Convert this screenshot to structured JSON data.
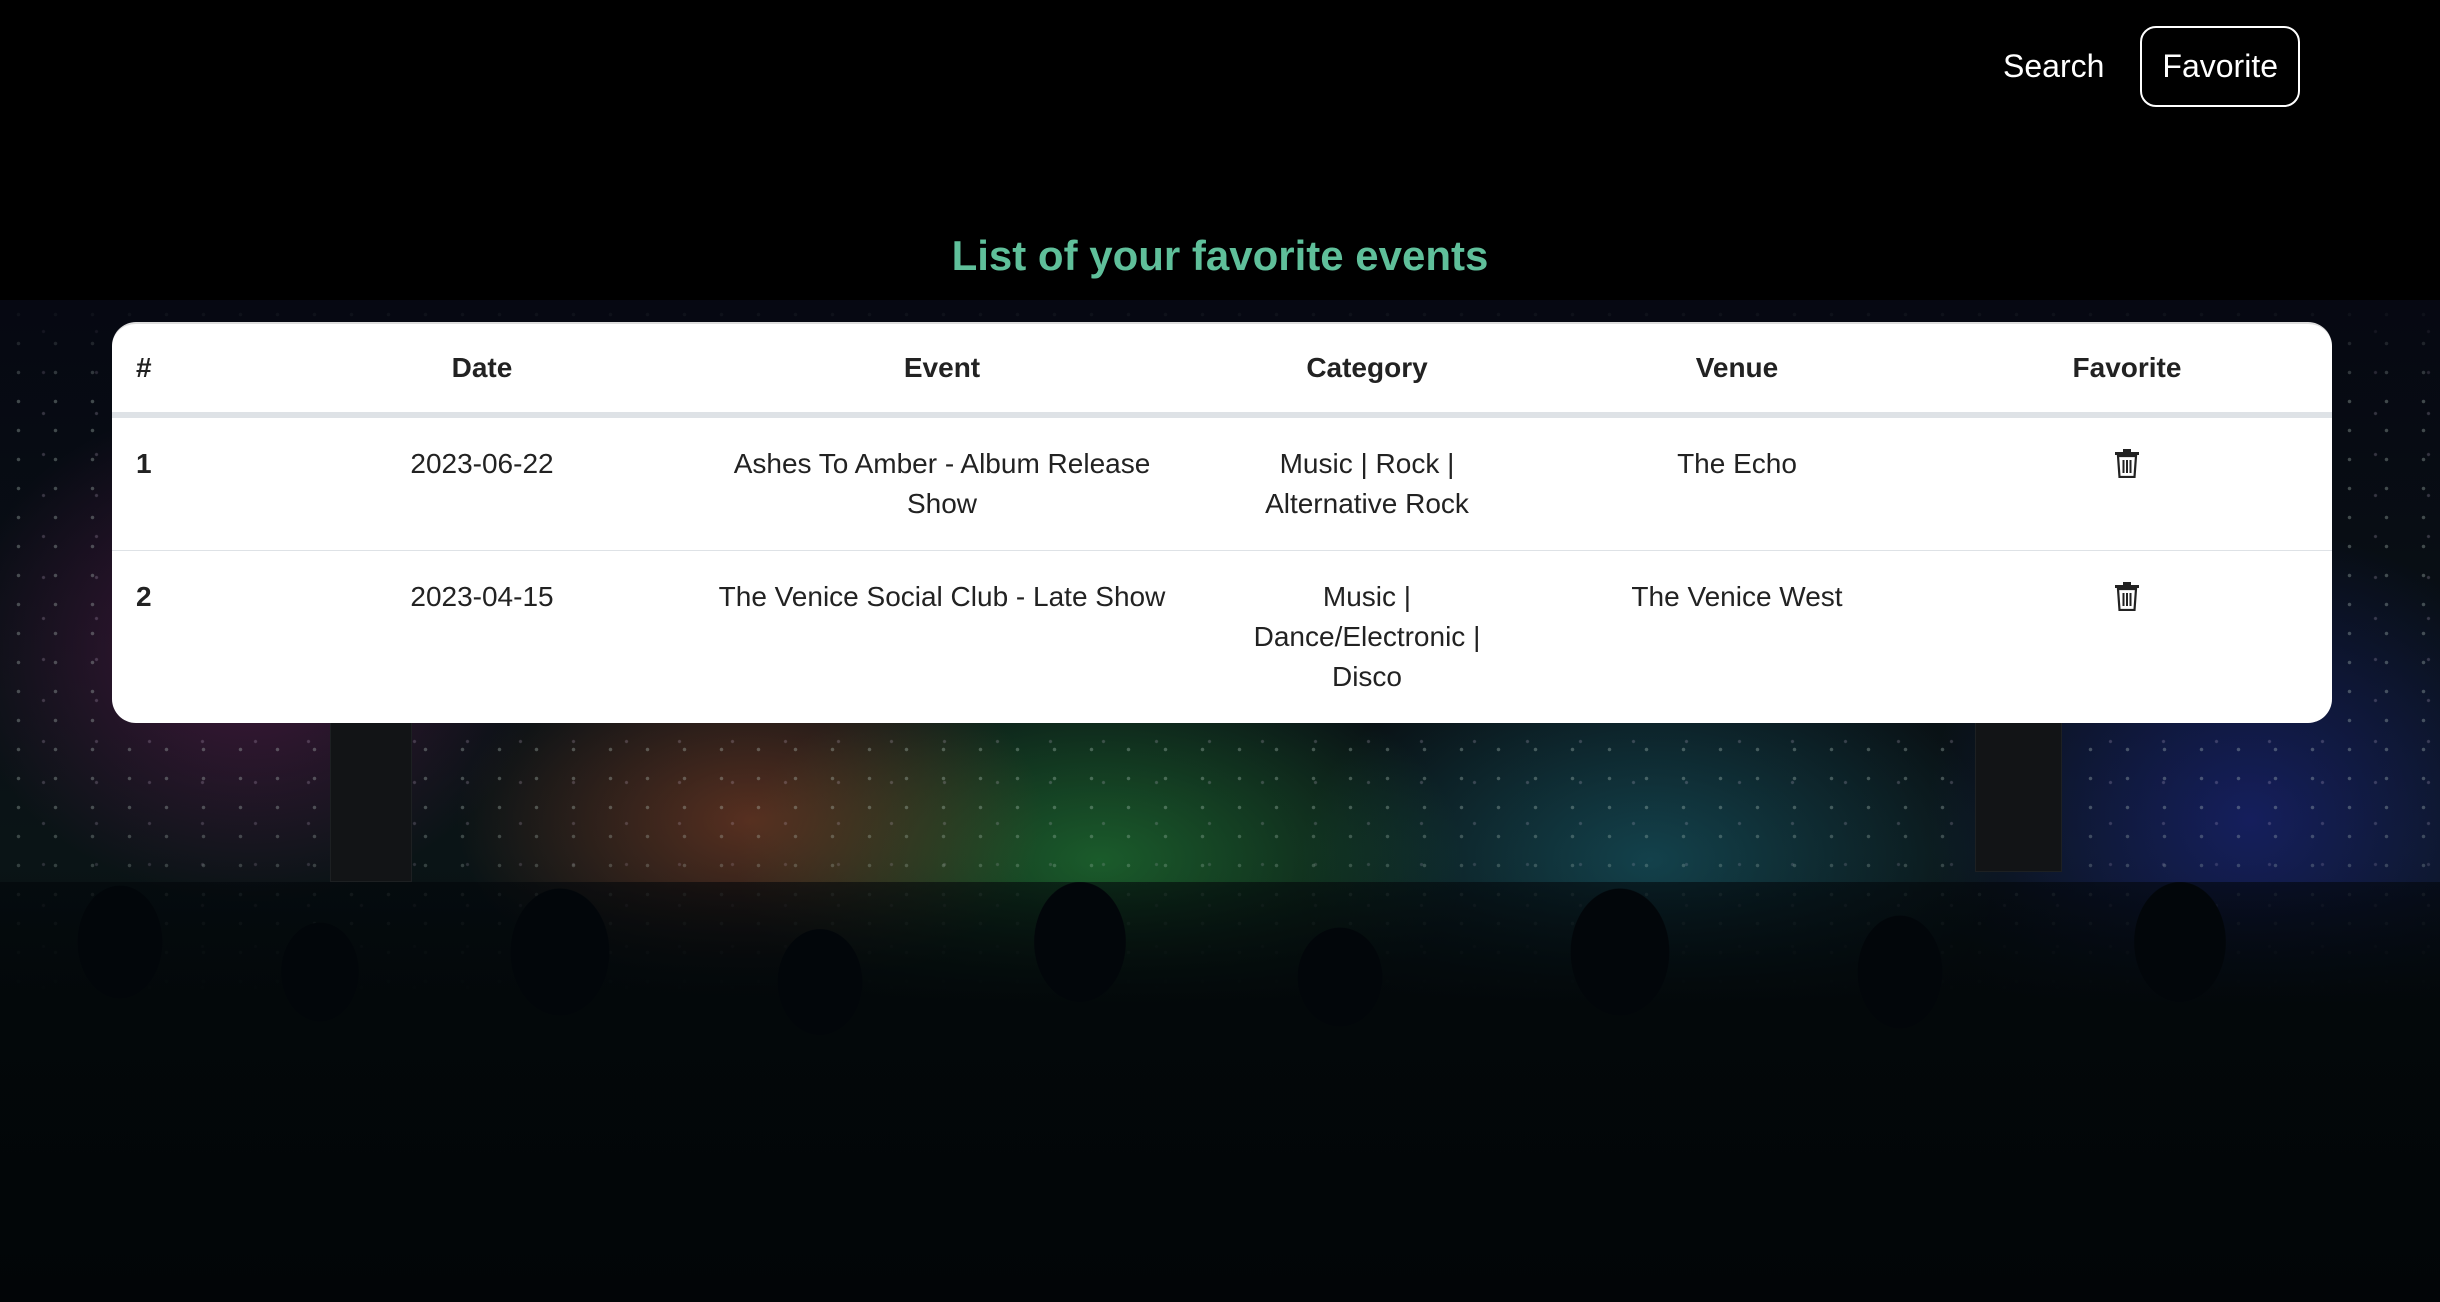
{
  "nav": {
    "search_label": "Search",
    "favorite_label": "Favorite"
  },
  "page_title": "List of your favorite events",
  "table": {
    "headers": [
      "#",
      "Date",
      "Event",
      "Category",
      "Venue",
      "Favorite"
    ],
    "rows": [
      {
        "index": "1",
        "date": "2023-06-22",
        "event": "Ashes To Amber - Album Release Show",
        "category": "Music | Rock | Alternative Rock",
        "venue": "The Echo",
        "action_icon": "trash-icon"
      },
      {
        "index": "2",
        "date": "2023-04-15",
        "event": "The Venice Social Club - Late Show",
        "category": "Music | Dance/Electronic | Disco",
        "venue": "The Venice West",
        "action_icon": "trash-icon"
      }
    ]
  },
  "colors": {
    "title": "#5fbf9a",
    "table_bg": "#ffffff",
    "page_bg": "#000000"
  }
}
